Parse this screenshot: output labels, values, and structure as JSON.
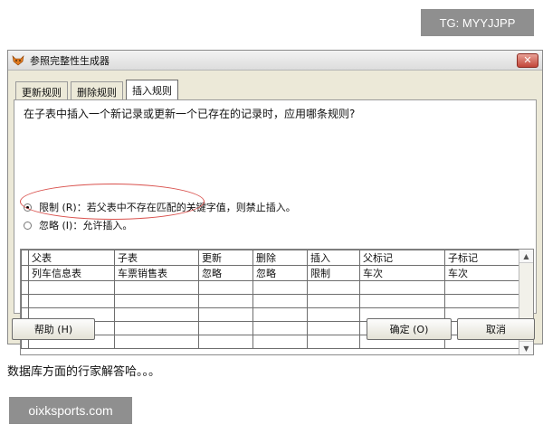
{
  "watermark": {
    "tg": "TG: MYYJJPP",
    "brand": "oixksports.com"
  },
  "window": {
    "title": "参照完整性生成器",
    "close_glyph": "✕"
  },
  "tabs": [
    {
      "label": "更新规则",
      "active": false
    },
    {
      "label": "删除规则",
      "active": false
    },
    {
      "label": "插入规则",
      "active": true
    }
  ],
  "panel": {
    "question": "在子表中插入一个新记录或更新一个已存在的记录时，应用哪条规则?",
    "options": [
      {
        "label": "限制 (R)：若父表中不存在匹配的关键字值，则禁止插入。",
        "checked": true
      },
      {
        "label": "忽略 (I)：允许插入。",
        "checked": false
      }
    ]
  },
  "grid": {
    "headers": [
      "父表",
      "子表",
      "更新",
      "删除",
      "插入",
      "父标记",
      "子标记"
    ],
    "rows": [
      [
        "列车信息表",
        "车票销售表",
        "忽略",
        "忽略",
        "限制",
        "车次",
        "车次"
      ]
    ]
  },
  "buttons": {
    "help": "帮助 (H)",
    "ok": "确定 (O)",
    "cancel": "取消"
  },
  "caption": "数据库方面的行家解答哈。。。",
  "colors": {
    "annotation": "#d9514d",
    "window_bg": "#ece9d8"
  }
}
